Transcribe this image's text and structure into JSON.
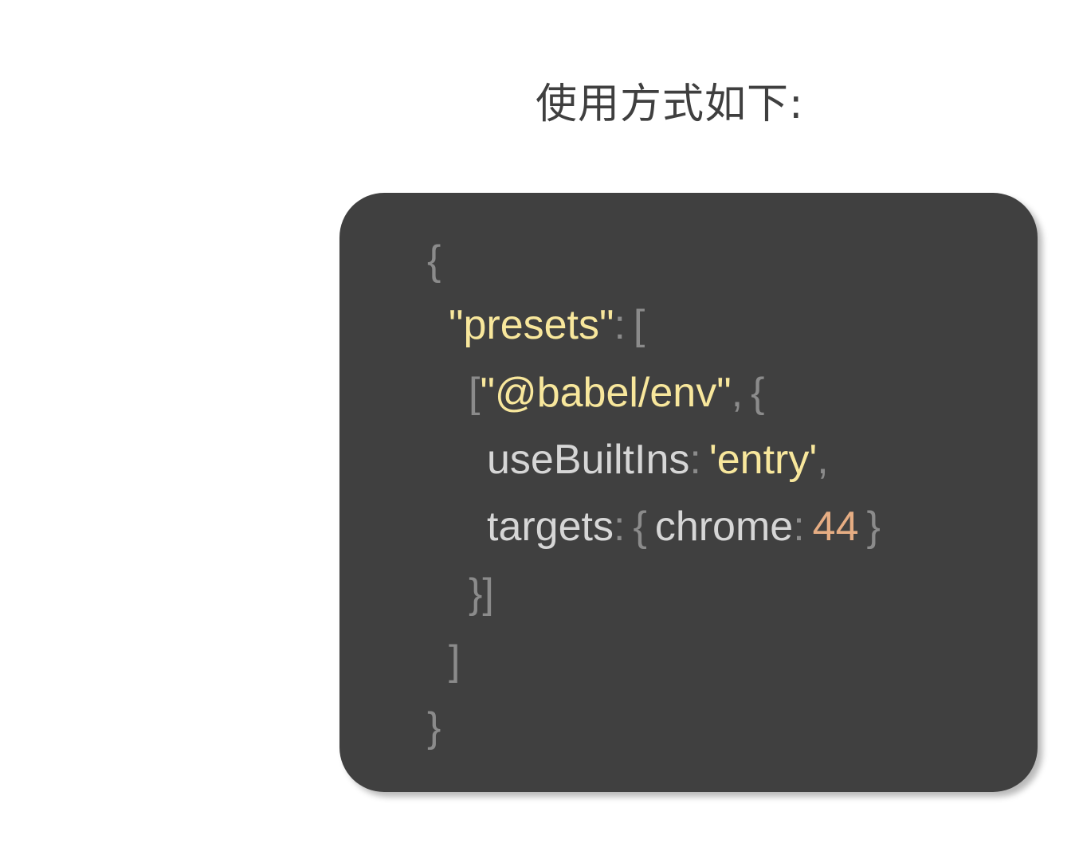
{
  "heading": "使用方式如下:",
  "code": {
    "line1": {
      "open_brace": "{"
    },
    "line2": {
      "key": "\"presets\"",
      "colon": ":",
      "open_bracket": "["
    },
    "line3": {
      "open_bracket": "[",
      "preset": "\"@babel/env\"",
      "comma": ",",
      "open_brace": "{"
    },
    "line4": {
      "key": "useBuiltIns",
      "colon": ":",
      "value": "'entry'",
      "comma": ","
    },
    "line5": {
      "key": "targets",
      "colon": ":",
      "open_brace": "{",
      "inner_key": "chrome",
      "inner_colon": ":",
      "inner_value": "44",
      "close_brace": "}"
    },
    "line6": {
      "close": "}]"
    },
    "line7": {
      "close": "]"
    },
    "line8": {
      "close": "}"
    }
  },
  "colors": {
    "card_background": "#404040",
    "string": "#f8e79c",
    "number": "#e6ad83",
    "punctuation": "#8b8b8b",
    "identifier": "#d6d6d6"
  }
}
